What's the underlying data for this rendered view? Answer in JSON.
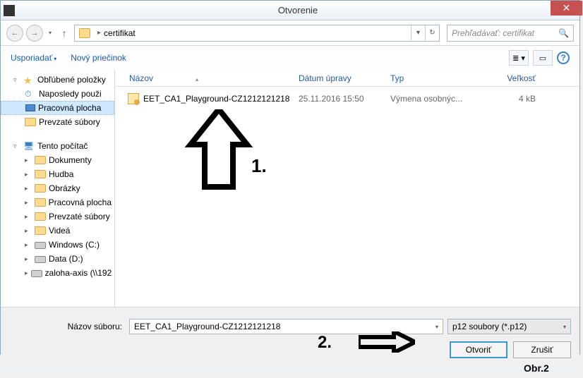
{
  "window": {
    "title": "Otvorenie"
  },
  "nav": {
    "path_segment": "certifikat",
    "search_placeholder": "Prehľadávať: certifikat"
  },
  "toolbar": {
    "organize": "Usporiadať",
    "new_folder": "Nový priečinok"
  },
  "sidebar": {
    "favorites": "Obľúbené položky",
    "recent": "Naposledy použi",
    "desktop": "Pracovná plocha",
    "downloads": "Prevzaté súbory",
    "this_pc": "Tento počítač",
    "documents": "Dokumenty",
    "music": "Hudba",
    "pictures": "Obrázky",
    "desktop2": "Pracovná plocha",
    "downloads2": "Prevzaté súbory",
    "videos": "Videá",
    "drive_c": "Windows (C:)",
    "drive_d": "Data (D:)",
    "network": "zaloha-axis (\\\\192"
  },
  "columns": {
    "name": "Názov",
    "date": "Dátum úpravy",
    "type": "Typ",
    "size": "Veľkosť"
  },
  "files": [
    {
      "name": "EET_CA1_Playground-CZ1212121218",
      "date": "25.11.2016 15:50",
      "type": "Výmena osobnýc...",
      "size": "4 kB"
    }
  ],
  "bottom": {
    "filename_label": "Názov súboru:",
    "filename_value": "EET_CA1_Playground-CZ1212121218",
    "filter": "p12 soubory (*.p12)",
    "open": "Otvoriť",
    "cancel": "Zrušiť"
  },
  "annotations": {
    "label1": "1.",
    "label2": "2.",
    "figure": "Obr.2"
  }
}
